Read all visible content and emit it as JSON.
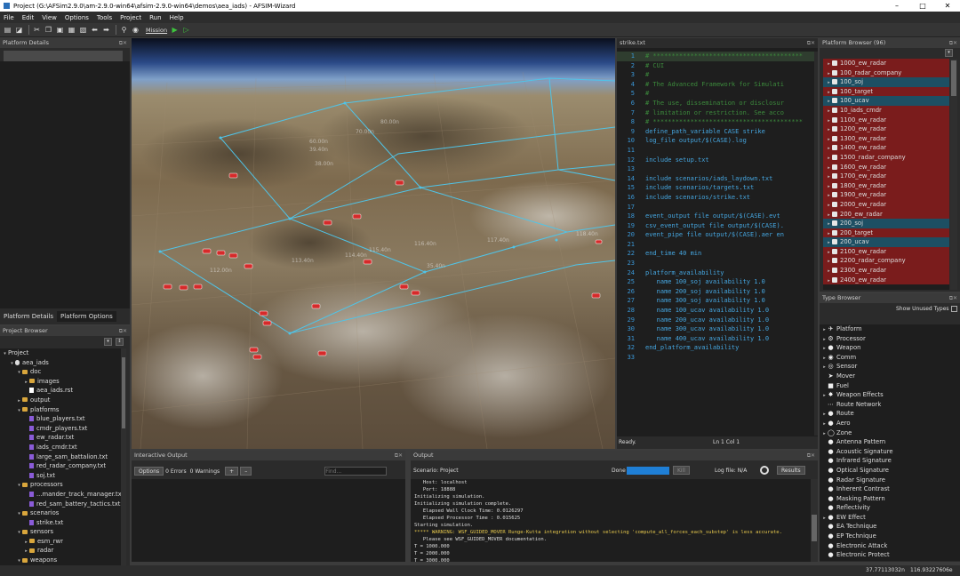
{
  "window": {
    "title": "Project (G:\\AFSim2.9.0\\am-2.9.0-win64\\afsim-2.9.0-win64\\demos\\aea_iads) - AFSIM-Wizard",
    "minimize": "–",
    "maximize": "□",
    "close": "✕"
  },
  "menu": [
    "File",
    "Edit",
    "View",
    "Options",
    "Tools",
    "Project",
    "Run",
    "Help"
  ],
  "toolbar": {
    "mission_label": "Mission"
  },
  "platform_details": {
    "title": "Platform Details",
    "tabs": [
      "Platform Details",
      "Platform Options"
    ]
  },
  "project_browser": {
    "title": "Project Browser",
    "tree": [
      {
        "label": "Project",
        "depth": 0,
        "icon": "none",
        "open": true
      },
      {
        "label": "aea_iads",
        "depth": 1,
        "icon": "globe",
        "open": true
      },
      {
        "label": "doc",
        "depth": 2,
        "icon": "folder",
        "open": true
      },
      {
        "label": "images",
        "depth": 3,
        "icon": "folder",
        "open": false
      },
      {
        "label": "aea_iads.rst",
        "depth": 3,
        "icon": "doc"
      },
      {
        "label": "output",
        "depth": 2,
        "icon": "folder",
        "open": false
      },
      {
        "label": "platforms",
        "depth": 2,
        "icon": "folder",
        "open": true
      },
      {
        "label": "blue_players.txt",
        "depth": 3,
        "icon": "pdoc"
      },
      {
        "label": "cmdr_players.txt",
        "depth": 3,
        "icon": "pdoc"
      },
      {
        "label": "ew_radar.txt",
        "depth": 3,
        "icon": "pdoc"
      },
      {
        "label": "iads_cmdr.txt",
        "depth": 3,
        "icon": "pdoc"
      },
      {
        "label": "large_sam_battalion.txt",
        "depth": 3,
        "icon": "pdoc"
      },
      {
        "label": "red_radar_company.txt",
        "depth": 3,
        "icon": "pdoc"
      },
      {
        "label": "soj.txt",
        "depth": 3,
        "icon": "pdoc"
      },
      {
        "label": "processors",
        "depth": 2,
        "icon": "folder",
        "open": true
      },
      {
        "label": "...mander_track_manager.txt",
        "depth": 3,
        "icon": "pdoc"
      },
      {
        "label": "red_sam_battery_tactics.txt",
        "depth": 3,
        "icon": "pdoc"
      },
      {
        "label": "scenarios",
        "depth": 2,
        "icon": "folder",
        "open": true
      },
      {
        "label": "strike.txt",
        "depth": 3,
        "icon": "pdoc"
      },
      {
        "label": "sensors",
        "depth": 2,
        "icon": "folder",
        "open": true
      },
      {
        "label": "esm_rwr",
        "depth": 3,
        "icon": "folder",
        "open": false
      },
      {
        "label": "radar",
        "depth": 3,
        "icon": "folder",
        "open": false
      },
      {
        "label": "weapons",
        "depth": 2,
        "icon": "folder",
        "open": true
      }
    ]
  },
  "map_labels": [
    "80.00n",
    "70.00n",
    "60.00n",
    "39.40n",
    "38.00n",
    "112.00n",
    "113.40n",
    "114.40n",
    "115.40n",
    "116.40n",
    "117.40n",
    "118.40n",
    "35.40n"
  ],
  "editor": {
    "tab": "strike.txt",
    "status_left": "Ready.",
    "status_right": "Ln 1 Col 1",
    "lines": [
      "# ****************************************",
      "# CUI",
      "#",
      "# The Advanced Framework for Simulati",
      "#",
      "# The use, dissemination or disclosur",
      "# limitation or restriction. See acco",
      "# ****************************************",
      "define_path_variable CASE strike",
      "log_file output/$(CASE).log",
      "",
      "include setup.txt",
      "",
      "include scenarios/iads_laydown.txt",
      "include scenarios/targets.txt",
      "include scenarios/strike.txt",
      "",
      "event_output file output/$(CASE).evt",
      "csv_event_output file output/$(CASE).",
      "event_pipe file output/$(CASE).aer en",
      "",
      "end_time 40 min",
      "",
      "platform_availability",
      "   name 100_soj availability 1.0",
      "   name 200_soj availability 1.0",
      "   name 300_soj availability 1.0",
      "   name 100_ucav availability 1.0",
      "   name 200_ucav availability 1.0",
      "   name 300_ucav availability 1.0",
      "   name 400_ucav availability 1.0",
      "end_platform_availability",
      ""
    ]
  },
  "platform_browser": {
    "title": "Platform Browser (96)",
    "items": [
      {
        "label": "1000_ew_radar",
        "style": "red"
      },
      {
        "label": "100_radar_company",
        "style": "red"
      },
      {
        "label": "100_soj",
        "style": "teal"
      },
      {
        "label": "100_target",
        "style": "red"
      },
      {
        "label": "100_ucav",
        "style": "teal"
      },
      {
        "label": "10_iads_cmdr",
        "style": "red"
      },
      {
        "label": "1100_ew_radar",
        "style": "red"
      },
      {
        "label": "1200_ew_radar",
        "style": "red"
      },
      {
        "label": "1300_ew_radar",
        "style": "red"
      },
      {
        "label": "1400_ew_radar",
        "style": "red"
      },
      {
        "label": "1500_radar_company",
        "style": "red"
      },
      {
        "label": "1600_ew_radar",
        "style": "red"
      },
      {
        "label": "1700_ew_radar",
        "style": "red"
      },
      {
        "label": "1800_ew_radar",
        "style": "red"
      },
      {
        "label": "1900_ew_radar",
        "style": "red"
      },
      {
        "label": "2000_ew_radar",
        "style": "red"
      },
      {
        "label": "200_ew_radar",
        "style": "red"
      },
      {
        "label": "200_soj",
        "style": "teal"
      },
      {
        "label": "200_target",
        "style": "red"
      },
      {
        "label": "200_ucav",
        "style": "teal"
      },
      {
        "label": "2100_ew_radar",
        "style": "red"
      },
      {
        "label": "2200_radar_company",
        "style": "red"
      },
      {
        "label": "2300_ew_radar",
        "style": "red"
      },
      {
        "label": "2400_ew_radar",
        "style": "red"
      }
    ]
  },
  "type_browser": {
    "title": "Type Browser",
    "show_unused": "Show Unused Types",
    "items": [
      {
        "label": "Platform",
        "icon": "✈",
        "exp": true
      },
      {
        "label": "Processor",
        "icon": "⚙",
        "exp": true
      },
      {
        "label": "Weapon",
        "icon": "●",
        "exp": true
      },
      {
        "label": "Comm",
        "icon": "◉",
        "exp": true
      },
      {
        "label": "Sensor",
        "icon": "◎",
        "exp": true
      },
      {
        "label": "Mover",
        "icon": "➤",
        "exp": false
      },
      {
        "label": "Fuel",
        "icon": "■",
        "exp": false
      },
      {
        "label": "Weapon Effects",
        "icon": "✸",
        "exp": true
      },
      {
        "label": "Route Network",
        "icon": "⋯",
        "exp": false
      },
      {
        "label": "Route",
        "icon": "●",
        "exp": true
      },
      {
        "label": "Aero",
        "icon": "●",
        "exp": true
      },
      {
        "label": "Zone",
        "icon": "◯",
        "exp": true
      },
      {
        "label": "Antenna Pattern",
        "icon": "●",
        "exp": false
      },
      {
        "label": "Acoustic Signature",
        "icon": "●",
        "exp": false
      },
      {
        "label": "Infrared Signature",
        "icon": "●",
        "exp": false
      },
      {
        "label": "Optical Signature",
        "icon": "●",
        "exp": false
      },
      {
        "label": "Radar Signature",
        "icon": "●",
        "exp": false
      },
      {
        "label": "Inherent Contrast",
        "icon": "●",
        "exp": false
      },
      {
        "label": "Masking Pattern",
        "icon": "●",
        "exp": false
      },
      {
        "label": "Reflectivity",
        "icon": "●",
        "exp": false
      },
      {
        "label": "EW Effect",
        "icon": "●",
        "exp": true
      },
      {
        "label": "EA Technique",
        "icon": "●",
        "exp": false
      },
      {
        "label": "EP Technique",
        "icon": "●",
        "exp": false
      },
      {
        "label": "Electronic Attack",
        "icon": "●",
        "exp": false
      },
      {
        "label": "Electronic Protect",
        "icon": "●",
        "exp": false
      }
    ]
  },
  "interactive_output": {
    "title": "Interactive Output",
    "options": "Options",
    "errors": "0 Errors",
    "warnings": "0 Warnings",
    "plus": "+",
    "minus": "–",
    "find_placeholder": "Find..."
  },
  "output": {
    "title": "Output",
    "scenario": "Scenario: Project",
    "done": "Done",
    "kill": "Kill",
    "log_file": "Log file: N/A",
    "results": "Results",
    "progress": 1.0,
    "lines": [
      {
        "t": "   Host: localhost",
        "c": "#ddd"
      },
      {
        "t": "   Port: 18888",
        "c": "#ddd"
      },
      {
        "t": "Initializing simulation.",
        "c": "#ddd"
      },
      {
        "t": "Initializing simulation complete.",
        "c": "#ddd"
      },
      {
        "t": "   Elapsed Wall Clock Time: 0.0126297",
        "c": "#ddd"
      },
      {
        "t": "   Elapsed Processor Time : 0.015625",
        "c": "#ddd"
      },
      {
        "t": "Starting simulation.",
        "c": "#ddd"
      },
      {
        "t": "***** WARNING: WSF_GUIDED_MOVER Runge-Kutta integration without selecting 'compute_all_forces_each_substep' is less accurate.",
        "c": "#e6c84d"
      },
      {
        "t": "   Please see WSF_GUIDED_MOVER documentation.",
        "c": "#ddd"
      },
      {
        "t": "T = 1000.000",
        "c": "#ddd"
      },
      {
        "t": "T = 2000.000",
        "c": "#ddd"
      },
      {
        "t": "T = 3000.000",
        "c": "#ddd"
      }
    ]
  },
  "status_bar": {
    "lat": "37.77113032n",
    "lon": "116.93227606e"
  }
}
